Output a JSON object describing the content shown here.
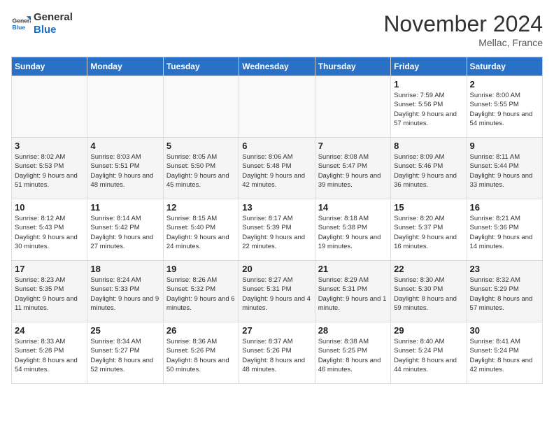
{
  "logo": {
    "line1": "General",
    "line2": "Blue"
  },
  "title": "November 2024",
  "location": "Mellac, France",
  "days_of_week": [
    "Sunday",
    "Monday",
    "Tuesday",
    "Wednesday",
    "Thursday",
    "Friday",
    "Saturday"
  ],
  "weeks": [
    [
      {
        "day": "",
        "info": "",
        "empty": true
      },
      {
        "day": "",
        "info": "",
        "empty": true
      },
      {
        "day": "",
        "info": "",
        "empty": true
      },
      {
        "day": "",
        "info": "",
        "empty": true
      },
      {
        "day": "",
        "info": "",
        "empty": true
      },
      {
        "day": "1",
        "info": "Sunrise: 7:59 AM\nSunset: 5:56 PM\nDaylight: 9 hours and 57 minutes.",
        "empty": false
      },
      {
        "day": "2",
        "info": "Sunrise: 8:00 AM\nSunset: 5:55 PM\nDaylight: 9 hours and 54 minutes.",
        "empty": false
      }
    ],
    [
      {
        "day": "3",
        "info": "Sunrise: 8:02 AM\nSunset: 5:53 PM\nDaylight: 9 hours and 51 minutes.",
        "empty": false
      },
      {
        "day": "4",
        "info": "Sunrise: 8:03 AM\nSunset: 5:51 PM\nDaylight: 9 hours and 48 minutes.",
        "empty": false
      },
      {
        "day": "5",
        "info": "Sunrise: 8:05 AM\nSunset: 5:50 PM\nDaylight: 9 hours and 45 minutes.",
        "empty": false
      },
      {
        "day": "6",
        "info": "Sunrise: 8:06 AM\nSunset: 5:48 PM\nDaylight: 9 hours and 42 minutes.",
        "empty": false
      },
      {
        "day": "7",
        "info": "Sunrise: 8:08 AM\nSunset: 5:47 PM\nDaylight: 9 hours and 39 minutes.",
        "empty": false
      },
      {
        "day": "8",
        "info": "Sunrise: 8:09 AM\nSunset: 5:46 PM\nDaylight: 9 hours and 36 minutes.",
        "empty": false
      },
      {
        "day": "9",
        "info": "Sunrise: 8:11 AM\nSunset: 5:44 PM\nDaylight: 9 hours and 33 minutes.",
        "empty": false
      }
    ],
    [
      {
        "day": "10",
        "info": "Sunrise: 8:12 AM\nSunset: 5:43 PM\nDaylight: 9 hours and 30 minutes.",
        "empty": false
      },
      {
        "day": "11",
        "info": "Sunrise: 8:14 AM\nSunset: 5:42 PM\nDaylight: 9 hours and 27 minutes.",
        "empty": false
      },
      {
        "day": "12",
        "info": "Sunrise: 8:15 AM\nSunset: 5:40 PM\nDaylight: 9 hours and 24 minutes.",
        "empty": false
      },
      {
        "day": "13",
        "info": "Sunrise: 8:17 AM\nSunset: 5:39 PM\nDaylight: 9 hours and 22 minutes.",
        "empty": false
      },
      {
        "day": "14",
        "info": "Sunrise: 8:18 AM\nSunset: 5:38 PM\nDaylight: 9 hours and 19 minutes.",
        "empty": false
      },
      {
        "day": "15",
        "info": "Sunrise: 8:20 AM\nSunset: 5:37 PM\nDaylight: 9 hours and 16 minutes.",
        "empty": false
      },
      {
        "day": "16",
        "info": "Sunrise: 8:21 AM\nSunset: 5:36 PM\nDaylight: 9 hours and 14 minutes.",
        "empty": false
      }
    ],
    [
      {
        "day": "17",
        "info": "Sunrise: 8:23 AM\nSunset: 5:35 PM\nDaylight: 9 hours and 11 minutes.",
        "empty": false
      },
      {
        "day": "18",
        "info": "Sunrise: 8:24 AM\nSunset: 5:33 PM\nDaylight: 9 hours and 9 minutes.",
        "empty": false
      },
      {
        "day": "19",
        "info": "Sunrise: 8:26 AM\nSunset: 5:32 PM\nDaylight: 9 hours and 6 minutes.",
        "empty": false
      },
      {
        "day": "20",
        "info": "Sunrise: 8:27 AM\nSunset: 5:31 PM\nDaylight: 9 hours and 4 minutes.",
        "empty": false
      },
      {
        "day": "21",
        "info": "Sunrise: 8:29 AM\nSunset: 5:31 PM\nDaylight: 9 hours and 1 minute.",
        "empty": false
      },
      {
        "day": "22",
        "info": "Sunrise: 8:30 AM\nSunset: 5:30 PM\nDaylight: 8 hours and 59 minutes.",
        "empty": false
      },
      {
        "day": "23",
        "info": "Sunrise: 8:32 AM\nSunset: 5:29 PM\nDaylight: 8 hours and 57 minutes.",
        "empty": false
      }
    ],
    [
      {
        "day": "24",
        "info": "Sunrise: 8:33 AM\nSunset: 5:28 PM\nDaylight: 8 hours and 54 minutes.",
        "empty": false
      },
      {
        "day": "25",
        "info": "Sunrise: 8:34 AM\nSunset: 5:27 PM\nDaylight: 8 hours and 52 minutes.",
        "empty": false
      },
      {
        "day": "26",
        "info": "Sunrise: 8:36 AM\nSunset: 5:26 PM\nDaylight: 8 hours and 50 minutes.",
        "empty": false
      },
      {
        "day": "27",
        "info": "Sunrise: 8:37 AM\nSunset: 5:26 PM\nDaylight: 8 hours and 48 minutes.",
        "empty": false
      },
      {
        "day": "28",
        "info": "Sunrise: 8:38 AM\nSunset: 5:25 PM\nDaylight: 8 hours and 46 minutes.",
        "empty": false
      },
      {
        "day": "29",
        "info": "Sunrise: 8:40 AM\nSunset: 5:24 PM\nDaylight: 8 hours and 44 minutes.",
        "empty": false
      },
      {
        "day": "30",
        "info": "Sunrise: 8:41 AM\nSunset: 5:24 PM\nDaylight: 8 hours and 42 minutes.",
        "empty": false
      }
    ]
  ]
}
